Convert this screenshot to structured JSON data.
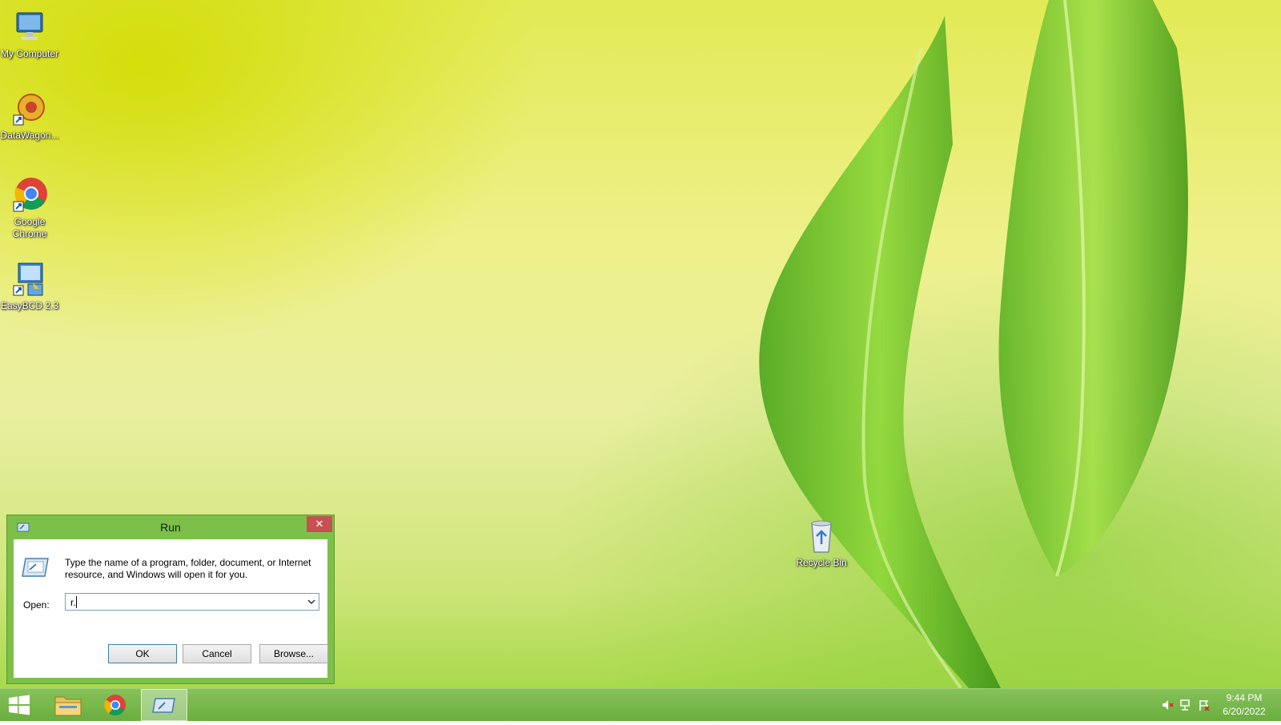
{
  "desktop": {
    "icons": [
      {
        "label": "My Computer",
        "icon": "computer-icon"
      },
      {
        "label": "DataWagon...",
        "icon": "datawagon-icon"
      },
      {
        "label": "Google Chrome",
        "icon": "chrome-icon"
      },
      {
        "label": "EasyBCD 2.3",
        "icon": "easybcd-icon"
      },
      {
        "label": "Recycle Bin",
        "icon": "recycle-bin-icon"
      }
    ]
  },
  "run_dialog": {
    "title": "Run",
    "close_label": "✕",
    "description": "Type the name of a program, folder, document, or Internet resource, and Windows will open it for you.",
    "open_label": "Open:",
    "open_value": "r.",
    "ok_label": "OK",
    "cancel_label": "Cancel",
    "browse_label": "Browse..."
  },
  "taskbar": {
    "items": [
      "start-icon",
      "file-explorer-icon",
      "chrome-icon",
      "run-icon"
    ],
    "tray": [
      "volume-muted-icon",
      "network-icon",
      "action-center-icon"
    ],
    "clock_time": "9:44 PM",
    "clock_date": "6/20/2022"
  },
  "colors": {
    "accent": "#7cc04a",
    "taskbar": "#6aae3e",
    "close_button": "#c75050"
  }
}
